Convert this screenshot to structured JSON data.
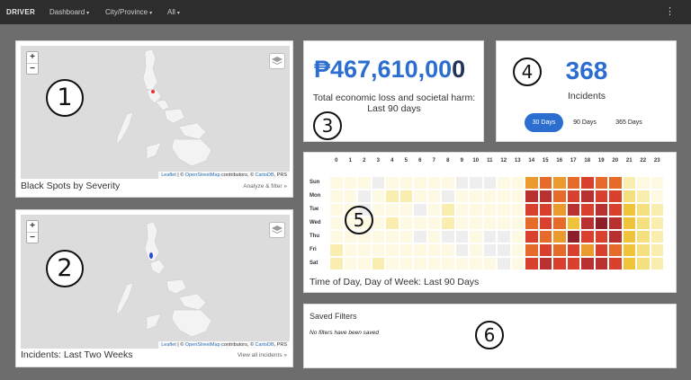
{
  "navbar": {
    "brand": "DRIVER",
    "menus": [
      {
        "label": "Dashboard",
        "caret": "▾"
      },
      {
        "label": "City/Province",
        "caret": "▾"
      },
      {
        "label": "All",
        "caret": "▾"
      }
    ],
    "kebab": "⋮"
  },
  "map_widget": {
    "zoom_in": "+",
    "zoom_out": "−",
    "layers_icon": "layers-icon"
  },
  "map_black_spots": {
    "attribution": {
      "leaflet": "Leaflet",
      "sep": " | © ",
      "osm": "OpenStreetMap",
      "mid": " contributors, © ",
      "carto": "CartoDB",
      "end": ", PRS"
    },
    "title": "Black Spots by Severity",
    "link": "Analyze & filter »",
    "marker_color": "#e03030"
  },
  "map_recent": {
    "attribution": {
      "leaflet": "Leaflet",
      "sep": " | © ",
      "osm": "OpenStreetMap",
      "mid": " contributors, © ",
      "carto": "CartoDB",
      "end": ", PRS"
    },
    "title": "Incidents: Last Two Weeks",
    "link": "View all incidents »",
    "marker_color": "#2b4fd0"
  },
  "economic_loss": {
    "amount_main": "₱467,610,00",
    "amount_tail": "0",
    "caption": "Total economic loss and societal harm: Last 90 days"
  },
  "incidents_count": {
    "count": "368",
    "caption": "Incidents",
    "ranges": [
      {
        "label": "30 Days",
        "active": true
      },
      {
        "label": "90 Days",
        "active": false
      },
      {
        "label": "365 Days",
        "active": false
      }
    ]
  },
  "heatmap": {
    "title": "Time of Day, Day of Week: Last 90 Days",
    "hours": [
      "0",
      "1",
      "2",
      "3",
      "4",
      "5",
      "6",
      "7",
      "8",
      "9",
      "10",
      "11",
      "12",
      "13",
      "14",
      "15",
      "16",
      "17",
      "18",
      "19",
      "20",
      "21",
      "22",
      "23"
    ],
    "days": [
      "Sun",
      "Mon",
      "Tue",
      "Wed",
      "Thu",
      "Fri",
      "Sat"
    ],
    "palette": {
      "0": "#fdf9e3",
      "1": "#eeeeee",
      "2": "#f9eeb0",
      "3": "#f5e07f",
      "4": "#f0c43a",
      "5": "#eb9a2e",
      "6": "#e66a2a",
      "7": "#d9402e",
      "8": "#b8302f",
      "9": "#8e1f2a"
    },
    "levels": [
      [
        0,
        0,
        0,
        1,
        0,
        0,
        0,
        0,
        0,
        1,
        1,
        1,
        0,
        0,
        5,
        6,
        5,
        6,
        7,
        6,
        6,
        2,
        0,
        0
      ],
      [
        0,
        0,
        1,
        0,
        2,
        2,
        0,
        0,
        1,
        0,
        0,
        0,
        0,
        0,
        8,
        8,
        6,
        7,
        8,
        7,
        7,
        3,
        2,
        0
      ],
      [
        0,
        0,
        1,
        0,
        0,
        0,
        1,
        0,
        2,
        0,
        0,
        0,
        0,
        0,
        7,
        7,
        5,
        8,
        7,
        8,
        7,
        4,
        3,
        2
      ],
      [
        0,
        0,
        0,
        0,
        2,
        0,
        0,
        0,
        2,
        0,
        0,
        0,
        0,
        0,
        6,
        7,
        6,
        4,
        8,
        9,
        8,
        4,
        3,
        2
      ],
      [
        0,
        0,
        0,
        0,
        0,
        0,
        1,
        0,
        1,
        1,
        0,
        1,
        1,
        0,
        7,
        6,
        5,
        9,
        7,
        7,
        8,
        4,
        3,
        2
      ],
      [
        2,
        0,
        0,
        0,
        0,
        0,
        0,
        0,
        0,
        1,
        0,
        1,
        1,
        0,
        6,
        7,
        6,
        7,
        5,
        7,
        6,
        4,
        3,
        2
      ],
      [
        2,
        0,
        0,
        2,
        0,
        0,
        0,
        0,
        0,
        0,
        0,
        0,
        1,
        0,
        7,
        8,
        7,
        7,
        8,
        8,
        7,
        4,
        3,
        2
      ]
    ]
  },
  "saved_filters": {
    "title": "Saved Filters",
    "empty_message": "No filters have been saved"
  },
  "callouts": [
    "1",
    "2",
    "3",
    "4",
    "5",
    "6"
  ]
}
